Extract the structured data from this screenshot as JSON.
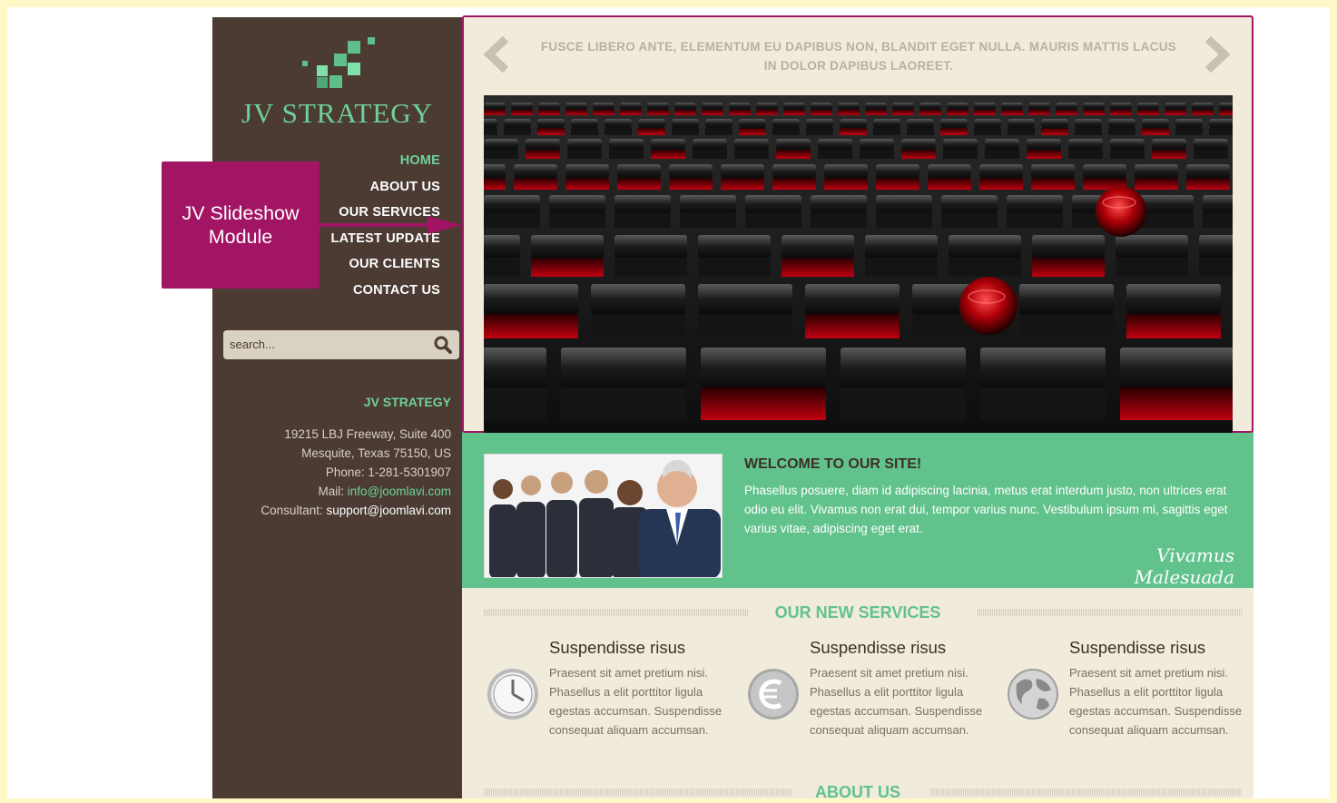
{
  "brand": {
    "name": "JV STRATEGY"
  },
  "nav": {
    "items": [
      "HOME",
      "ABOUT US",
      "OUR SERVICES",
      "LATEST UPDATE",
      "OUR CLIENTS",
      "CONTACT US"
    ],
    "active_index": 0
  },
  "search": {
    "placeholder": "search..."
  },
  "contact": {
    "title": "JV STRATEGY",
    "address1": "19215 LBJ Freeway, Suite 400",
    "address2": "Mesquite, Texas 75150, US",
    "phone_label": "Phone:",
    "phone": "1-281-5301907",
    "mail_label": "Mail:",
    "mail": "info@joomlavi.com",
    "consultant_label": "Consultant:",
    "consultant": "support@joomlavi.com"
  },
  "slideshow": {
    "caption": "FUSCE LIBERO ANTE, ELEMENTUM EU DAPIBUS NON, BLANDIT EGET NULLA. MAURIS MATTIS LACUS IN DOLOR DAPIBUS LAOREET.",
    "prev_icon": "chevron-left-icon",
    "next_icon": "chevron-right-icon"
  },
  "welcome": {
    "title": "WELCOME TO OUR SITE!",
    "text": "Phasellus posuere, diam id adipiscing lacinia, metus erat interdum justo, non ultrices erat odio eu elit. Vivamus non erat dui, tempor varius nunc. Vestibulum ipsum mi, sagittis eget varius vitae, adipiscing eget erat.",
    "signature": "Vivamus Malesuada"
  },
  "services": {
    "heading": "OUR NEW SERVICES",
    "items": [
      {
        "icon": "clock-icon",
        "title": "Suspendisse risus",
        "text": "Praesent sit amet pretium nisi. Phasellus a elit porttitor ligula egestas accumsan. Suspendisse consequat aliquam accumsan."
      },
      {
        "icon": "euro-icon",
        "title": "Suspendisse risus",
        "text": "Praesent sit amet pretium nisi. Phasellus a elit porttitor ligula egestas accumsan. Suspendisse consequat aliquam accumsan."
      },
      {
        "icon": "globe-icon",
        "title": "Suspendisse risus",
        "text": "Praesent sit amet pretium nisi. Phasellus a elit porttitor ligula egestas accumsan. Suspendisse consequat aliquam accumsan."
      }
    ]
  },
  "about": {
    "heading": "ABOUT US"
  },
  "callout": {
    "text": "JV Slideshow Module"
  },
  "colors": {
    "sidebar": "#4b3b33",
    "accent_green": "#62c28c",
    "callout_magenta": "#a21464",
    "content_bg": "#f1ebdb",
    "page_frame": "#fff8c8"
  }
}
